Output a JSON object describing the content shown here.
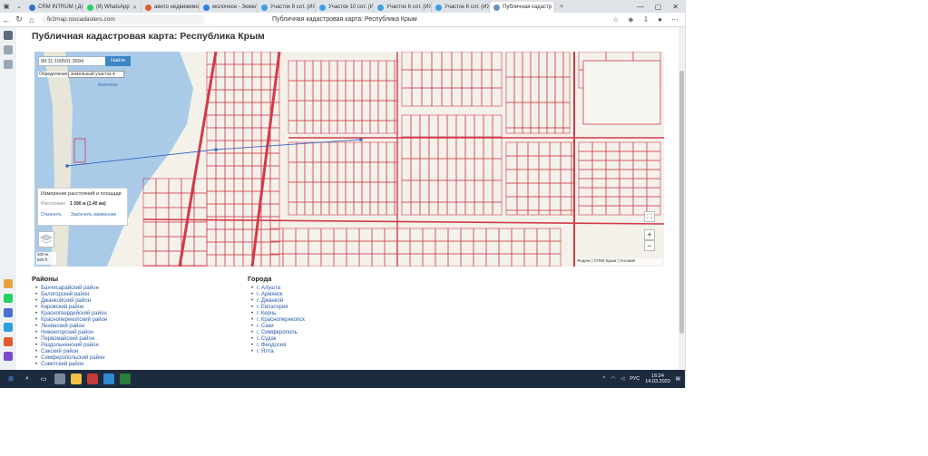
{
  "browser": {
    "tabs": [
      {
        "label": "CRM INTRUM | Дом",
        "color": "#2f6fd1"
      },
      {
        "label": "(8) WhatsApp",
        "color": "#25d366"
      },
      {
        "label": "авито недвижимость",
        "color": "#e05a2b"
      },
      {
        "label": "молочное - Земель",
        "color": "#2b7de0"
      },
      {
        "label": "Участок 8 сот. (ИЖ",
        "color": "#3aa0e0"
      },
      {
        "label": "Участок 10 сот. (И",
        "color": "#3aa0e0"
      },
      {
        "label": "Участок 6 сот. (ИЖ",
        "color": "#3aa0e0"
      },
      {
        "label": "Участок 6 сот. (ИЖ",
        "color": "#3aa0e0"
      },
      {
        "label": "Публичная кадастр",
        "color": "#6a8fbf"
      }
    ],
    "url": "fir2map.roscadasters.com",
    "page_title": "Публичная кадастровая карта: Республика Крым"
  },
  "page": {
    "heading": "Публичная кадастровая карта: Республика Крым"
  },
  "map": {
    "search_value": "90:11:150501:3694",
    "find_label": "Найти",
    "define_label": "Определение:",
    "define_value": "земельный участок",
    "lake_label": "Акпечное",
    "measure": {
      "title": "Измерение расстояний и площади",
      "result_label": "Расстояние",
      "result_value": "1 390 м (1.40 км)",
      "cancel_label": "Отменить",
      "finish_label": "Закончить измерение"
    },
    "fullscreen_symbol": "⛶",
    "zoom_in": "+",
    "zoom_out": "−",
    "scale_lines": [
      "300 м",
      "500 ft"
    ],
    "copyright": "Яндекс | ©ПКК Крым | Условия"
  },
  "districts": {
    "title": "Районы",
    "items": [
      "Бахчисарайский район",
      "Белогорский район",
      "Джанкойский район",
      "Кировский район",
      "Красногвардейский район",
      "Красноперекопский район",
      "Ленинский район",
      "Нижнегорский район",
      "Первомайский район",
      "Раздольненский район",
      "Сакский район",
      "Симферопольский район",
      "Советский район"
    ]
  },
  "cities": {
    "title": "Города",
    "items": [
      "г. Алушта",
      "г. Армянск",
      "г. Джанкой",
      "г. Евпатория",
      "г. Керчь",
      "г. Красноперекопск",
      "г. Саки",
      "г. Симферополь",
      "г. Судак",
      "г. Феодосия",
      "г. Ялта"
    ]
  },
  "taskbar": {
    "lang": "РУС",
    "time": "16:24",
    "date": "14.03.2023"
  },
  "colors": {
    "parcel_red": "#d23a4a",
    "water": "#a9cbe8",
    "link": "#2a5da8",
    "accent": "#3d86c6"
  }
}
